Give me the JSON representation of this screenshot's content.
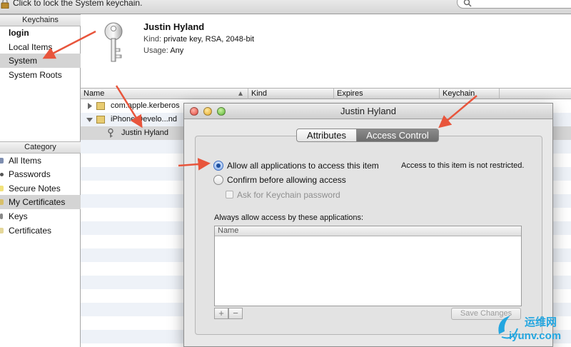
{
  "topbar": {
    "lock_text": "Click to lock the System keychain."
  },
  "keychains": {
    "header": "Keychains",
    "items": [
      {
        "label": "login",
        "bold": true
      },
      {
        "label": "Local Items",
        "bold": false
      },
      {
        "label": "System",
        "bold": false,
        "selected": true
      },
      {
        "label": "System Roots",
        "bold": false
      }
    ]
  },
  "category": {
    "header": "Category",
    "items": [
      {
        "label": "All Items",
        "icon": "all-items-icon"
      },
      {
        "label": "Passwords",
        "icon": "passwords-icon"
      },
      {
        "label": "Secure Notes",
        "icon": "secure-notes-icon"
      },
      {
        "label": "My Certificates",
        "icon": "my-certificates-icon",
        "selected": true
      },
      {
        "label": "Keys",
        "icon": "keys-icon"
      },
      {
        "label": "Certificates",
        "icon": "certificates-icon"
      }
    ]
  },
  "info": {
    "title": "Justin Hyland",
    "kind_label": "Kind:",
    "kind_value": "private key, RSA, 2048-bit",
    "usage_label": "Usage:",
    "usage_value": "Any"
  },
  "list": {
    "columns": [
      "Name",
      "Kind",
      "Expires",
      "Keychain"
    ],
    "rows": [
      {
        "name": "com.apple.kerberos",
        "disclosure": "closed"
      },
      {
        "name": "iPhone Develo...nd",
        "disclosure": "open"
      },
      {
        "name": "Justin Hyland",
        "disclosure": "none",
        "selected": true
      }
    ]
  },
  "dialog": {
    "title": "Justin Hyland",
    "tabs": [
      {
        "label": "Attributes",
        "active": false
      },
      {
        "label": "Access Control",
        "active": true
      }
    ],
    "option_allow": "Allow all applications to access this item",
    "option_confirm": "Confirm before allowing access",
    "ask_password": "Ask for Keychain password",
    "status_text": "Access to this item is not restricted.",
    "always_allow_label": "Always allow access by these applications:",
    "apps_column": "Name",
    "add_label": "+",
    "remove_label": "−",
    "save_label": "Save Changes"
  },
  "watermark": {
    "cn": "运维网",
    "en": "iyunv.com"
  },
  "colors": {
    "accent_arrow": "#e8553c",
    "selection_gray": "#d4d4d4",
    "watermark_blue": "#23a6e0"
  }
}
